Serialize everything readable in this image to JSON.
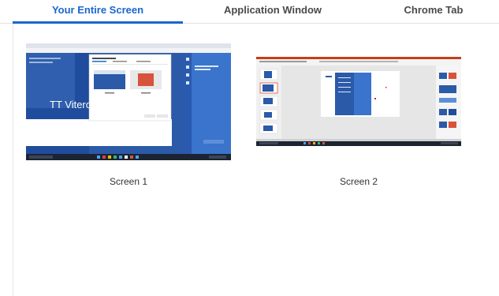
{
  "tabs": [
    {
      "label": "Your Entire Screen",
      "active": true
    },
    {
      "label": "Application Window",
      "active": false
    },
    {
      "label": "Chrome Tab",
      "active": false
    }
  ],
  "screens": [
    {
      "label": "Screen 1",
      "preview_text": "TT Vitero"
    },
    {
      "label": "Screen 2"
    }
  ],
  "colors": {
    "accent": "#1a66cf",
    "tab_text": "#4a4a4a",
    "desktop_blue": "#2a5aa8"
  }
}
